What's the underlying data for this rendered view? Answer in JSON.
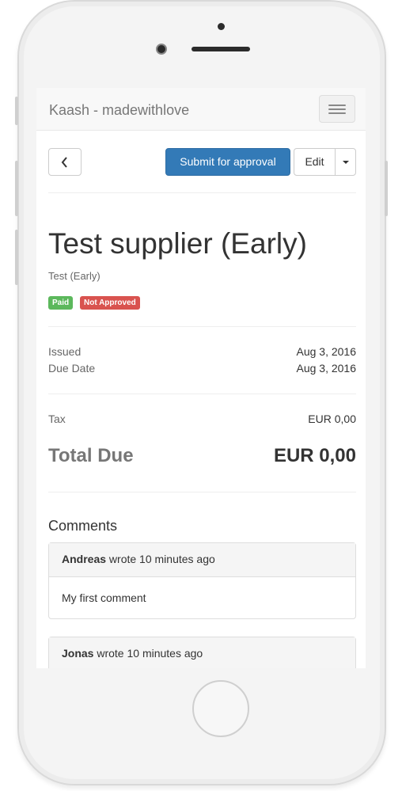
{
  "navbar": {
    "brand": "Kaash - madewithlove"
  },
  "toolbar": {
    "back_icon": "chevron-left-icon",
    "submit_label": "Submit for approval",
    "edit_label": "Edit",
    "dropdown_icon": "caret-down-icon",
    "primary_color": "#337ab7"
  },
  "invoice": {
    "title": "Test supplier (Early)",
    "subtitle": "Test (Early)",
    "labels": [
      {
        "text": "Paid",
        "color": "#5cb85c"
      },
      {
        "text": "Not Approved",
        "color": "#d9534f"
      }
    ],
    "issued_label": "Issued",
    "issued_value": "Aug 3, 2016",
    "due_label": "Due Date",
    "due_value": "Aug 3, 2016",
    "tax_label": "Tax",
    "tax_value": "EUR 0,00",
    "total_label": "Total Due",
    "total_value": "EUR 0,00"
  },
  "comments": {
    "heading": "Comments",
    "items": [
      {
        "author": "Andreas",
        "meta": " wrote 10 minutes ago",
        "body": "My first comment"
      },
      {
        "author": "Jonas",
        "meta": " wrote 10 minutes ago",
        "body": ""
      }
    ]
  }
}
